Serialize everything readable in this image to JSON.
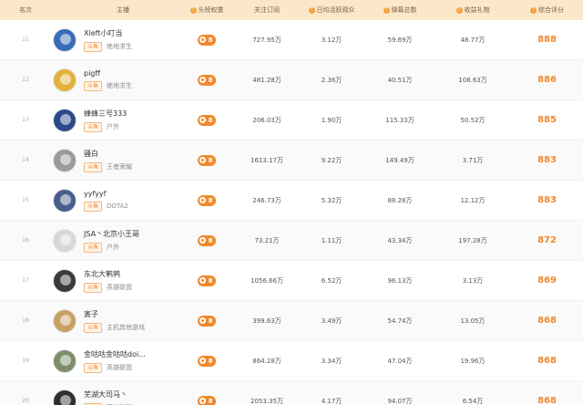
{
  "header": {
    "rank": "名次",
    "anchor": "主播",
    "weight": "头榜权重",
    "followers": "关注订阅",
    "daily_active": "日均活跃观众",
    "barrage": "弹幕总数",
    "gifts": "收益礼物",
    "score": "综合评分"
  },
  "rows": [
    {
      "rank": "11",
      "name": "Xleft小叮当",
      "platform": "斗鱼",
      "category": "绝地求生",
      "weight": "8",
      "followers": "727.95万",
      "daily": "3.12万",
      "barrage": "59.69万",
      "gifts": "48.77万",
      "score": "888",
      "avatar_color": "#3b6cb7"
    },
    {
      "rank": "12",
      "name": "pigff",
      "platform": "斗鱼",
      "category": "绝地求生",
      "weight": "8",
      "followers": "481.28万",
      "daily": "2.36万",
      "barrage": "40.51万",
      "gifts": "108.63万",
      "score": "886",
      "avatar_color": "#e2b23a"
    },
    {
      "rank": "13",
      "name": "蜂蜂三号333",
      "platform": "斗鱼",
      "category": "户外",
      "weight": "8",
      "followers": "206.03万",
      "daily": "1.90万",
      "barrage": "115.33万",
      "gifts": "50.52万",
      "score": "885",
      "avatar_color": "#2c4a8a"
    },
    {
      "rank": "14",
      "name": "骚白",
      "platform": "斗鱼",
      "category": "王者荣耀",
      "weight": "8",
      "followers": "1613.17万",
      "daily": "9.22万",
      "barrage": "149.49万",
      "gifts": "3.71万",
      "score": "883",
      "avatar_color": "#9a9a9a"
    },
    {
      "rank": "15",
      "name": "yyfyyf",
      "platform": "斗鱼",
      "category": "DOTA2",
      "weight": "8",
      "followers": "246.73万",
      "daily": "5.32万",
      "barrage": "88.28万",
      "gifts": "12.12万",
      "score": "883",
      "avatar_color": "#4a5e8c"
    },
    {
      "rank": "16",
      "name": "JSA丶北京小王哥",
      "platform": "斗鱼",
      "category": "户外",
      "weight": "8",
      "followers": "73.21万",
      "daily": "1.11万",
      "barrage": "43.34万",
      "gifts": "197.28万",
      "score": "872",
      "avatar_color": "#d8d8d8"
    },
    {
      "rank": "17",
      "name": "东北大鹌鹑",
      "platform": "斗鱼",
      "category": "英雄联盟",
      "weight": "8",
      "followers": "1056.66万",
      "daily": "6.52万",
      "barrage": "96.13万",
      "gifts": "3.13万",
      "score": "869",
      "avatar_color": "#3a3a3a"
    },
    {
      "rank": "18",
      "name": "寅子",
      "platform": "斗鱼",
      "category": "主机其他游戏",
      "weight": "8",
      "followers": "399.63万",
      "daily": "3.49万",
      "barrage": "54.74万",
      "gifts": "13.05万",
      "score": "868",
      "avatar_color": "#c9a064"
    },
    {
      "rank": "19",
      "name": "金咕咕金咕咕doi...",
      "platform": "斗鱼",
      "category": "英雄联盟",
      "weight": "8",
      "followers": "864.28万",
      "daily": "3.34万",
      "barrage": "47.04万",
      "gifts": "19.96万",
      "score": "868",
      "avatar_color": "#7d8f6a"
    },
    {
      "rank": "20",
      "name": "芜湖大司马丶",
      "platform": "斗鱼",
      "category": "英雄联盟",
      "weight": "8",
      "followers": "2053.35万",
      "daily": "4.17万",
      "barrage": "94.07万",
      "gifts": "6.54万",
      "score": "868",
      "avatar_color": "#2e2e2e"
    }
  ]
}
